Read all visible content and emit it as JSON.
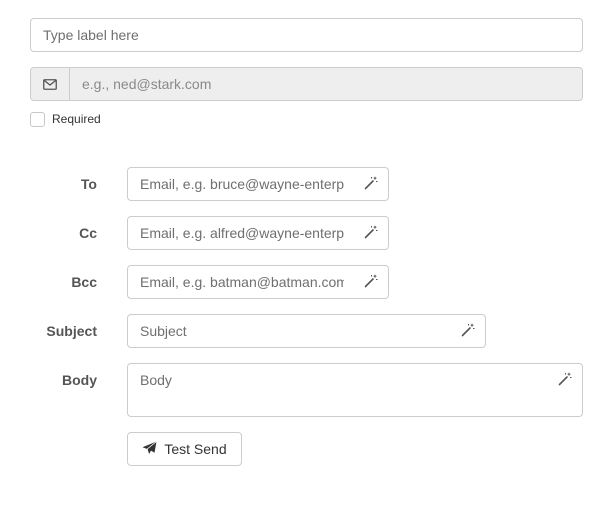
{
  "label_field": {
    "placeholder": "Type label here"
  },
  "email_field": {
    "placeholder": "e.g., ned@stark.com",
    "addon_icon": "envelope-icon"
  },
  "required_checkbox": {
    "label": "Required",
    "checked": false
  },
  "form": {
    "to": {
      "label": "To",
      "placeholder": "Email, e.g. bruce@wayne-enterprises.com"
    },
    "cc": {
      "label": "Cc",
      "placeholder": "Email, e.g. alfred@wayne-enterprises.com"
    },
    "bcc": {
      "label": "Bcc",
      "placeholder": "Email, e.g. batman@batman.com"
    },
    "subject": {
      "label": "Subject",
      "placeholder": "Subject"
    },
    "body": {
      "label": "Body",
      "placeholder": "Body"
    },
    "field_icon": "magic-wand-icon"
  },
  "test_send": {
    "label": "Test Send",
    "icon": "paper-plane-icon"
  }
}
